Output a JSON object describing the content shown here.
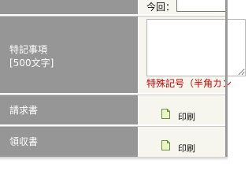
{
  "rows": {
    "top": {
      "label": "",
      "field_label": "今回：",
      "field_value": ""
    },
    "notes": {
      "label_line1": "特記事項",
      "label_line2": "[500文字]",
      "textarea_value": "",
      "warning": "特殊記号（半角カン"
    },
    "invoice": {
      "label": "請求書",
      "action": "印刷",
      "icon": "document-icon"
    },
    "receipt": {
      "label": "領収書",
      "action": "印刷",
      "icon": "document-icon"
    }
  },
  "colors": {
    "label_bg": "#969696",
    "value_bg": "#f6f5ee",
    "warning": "#cc0000",
    "icon_fill": "#e9f7c9",
    "icon_stroke": "#6c8f3a"
  }
}
